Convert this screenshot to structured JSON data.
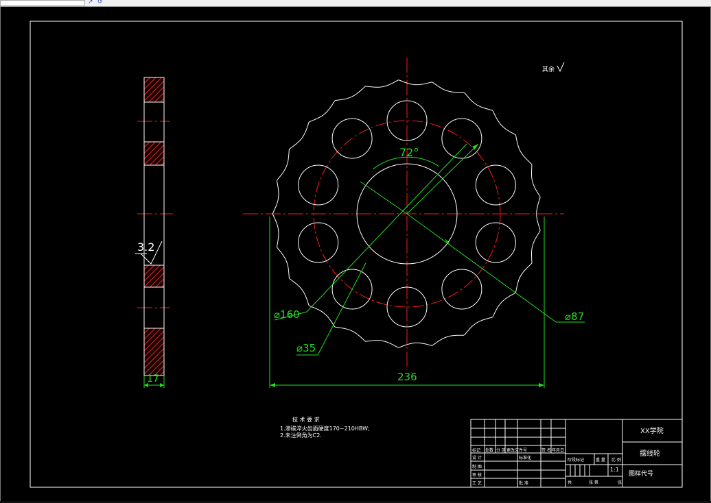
{
  "toolbar": {
    "icon_a": "↗",
    "icon_b": "↺"
  },
  "drawing": {
    "surface_roughness_note": "其余",
    "pitch_angle": "72°",
    "dim_hole_circle": "⌀160",
    "dim_hole": "⌀35",
    "dim_bore": "⌀87",
    "dim_outer_width": "236",
    "dim_thickness": "17",
    "roughness_value": "3.2"
  },
  "tech_requirements": {
    "heading": "技 术 要 求",
    "items": [
      "1.渗碳淬火齿面硬度170~210HBW;",
      "2.未注倒角为C2."
    ]
  },
  "title_block": {
    "school": "XX学院",
    "part_name": "摆线轮",
    "drawing_code": "图样代号",
    "scale": "1:1",
    "header_cells": [
      "标记",
      "处数",
      "分 区",
      "更改文件号",
      "签 名",
      "年月日"
    ],
    "row_labels": [
      "设 计",
      "制 图",
      "审 核",
      "工 艺"
    ],
    "std_label": "标准化",
    "approve_label": "批 准",
    "stage_labels": [
      "阶段标记",
      "重 量",
      "比 例"
    ],
    "sheet_labels": [
      "共",
      "张 第",
      "张"
    ]
  },
  "colors": {
    "line": "#ffffff",
    "center": "#ff1a1a",
    "dim": "#22e022",
    "hatch": "#cc1a1a",
    "bg": "#000000"
  }
}
